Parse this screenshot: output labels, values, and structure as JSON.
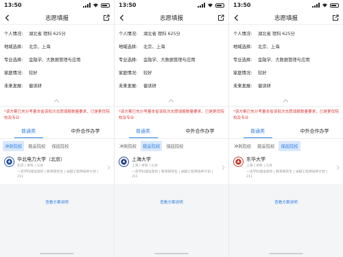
{
  "status": {
    "time": "13:50"
  },
  "nav": {
    "title": "志愿填报"
  },
  "labels": {
    "personal": "个人情况:",
    "region": "地域选择:",
    "major": "专业选择:",
    "family": "家庭情况:",
    "future": "未来发展:"
  },
  "values": {
    "personal": "湖北省   理科   625分",
    "region": "北京、上海",
    "major": "金融学、大数据管理与应用",
    "family": "较好",
    "future": "偏读研"
  },
  "notice": "*该方案已充分考量本省该批次志愿填报数量要求，已是更优院校及专业",
  "tabs": {
    "general": "普通类",
    "sino": "中外合作办学"
  },
  "subtabs": {
    "rush": "冲刺院校",
    "steady": "稳妥院校",
    "safe": "保底院校"
  },
  "screens": [
    {
      "selected_subtab": "rush",
      "school": "华北电力大学（北京）",
      "meta": "北京 | 本科 | 公办",
      "tags": "一流学科建设高校 | 教育研究生 | 卓越工程师培养计划 | 211",
      "logo_color": "#1f4e9c"
    },
    {
      "selected_subtab": "steady",
      "school": "上海大学",
      "meta": "上海 | 本科 | 公办",
      "tags": "一流学科建设高校 | 教育研究生 | 卓越工程师培养计划 | 211",
      "logo_color": "#1f3f8f"
    },
    {
      "selected_subtab": "safe",
      "school": "东华大学",
      "meta": "上海 | 本科 | 公办",
      "tags": "一流学科建设高校 | 教育研究生 | 卓越工程师培养计划 | 211",
      "logo_color": "#c0392b"
    }
  ],
  "plan_link": "查看方案说明",
  "colors": {
    "accent": "#2f7de1",
    "notice": "#e03a3a",
    "chip_bg": "#d9e9fb"
  }
}
